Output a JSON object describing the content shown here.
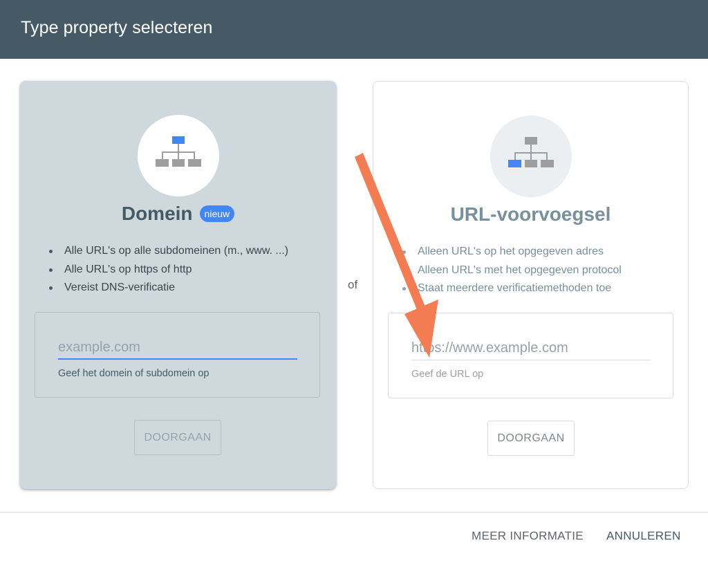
{
  "dialog": {
    "title": "Type property selecteren"
  },
  "domain_card": {
    "title": "Domein",
    "badge": "nieuw",
    "features": [
      "Alle URL's op alle subdomeinen (m., www. ...)",
      "Alle URL's op https of http",
      "Vereist DNS-verificatie"
    ],
    "input_placeholder": "example.com",
    "helper": "Geef het domein of subdomein op",
    "button_label": "DOORGAAN",
    "icon": "sitemap-icon"
  },
  "separator": "of",
  "url_card": {
    "title": "URL-voorvoegsel",
    "features": [
      "Alleen URL's op het opgegeven adres",
      "Alleen URL's met het opgegeven protocol",
      "Staat meerdere verificatiemethoden toe"
    ],
    "input_placeholder": "https://www.example.com",
    "helper": "Geef de URL op",
    "button_label": "DOORGAAN",
    "icon": "sitemap-icon"
  },
  "footer": {
    "more_info": "MEER INFORMATIE",
    "cancel": "ANNULEREN"
  },
  "colors": {
    "header": "#455a64",
    "accent": "#4285f4",
    "annotation_arrow": "#f47c52"
  }
}
